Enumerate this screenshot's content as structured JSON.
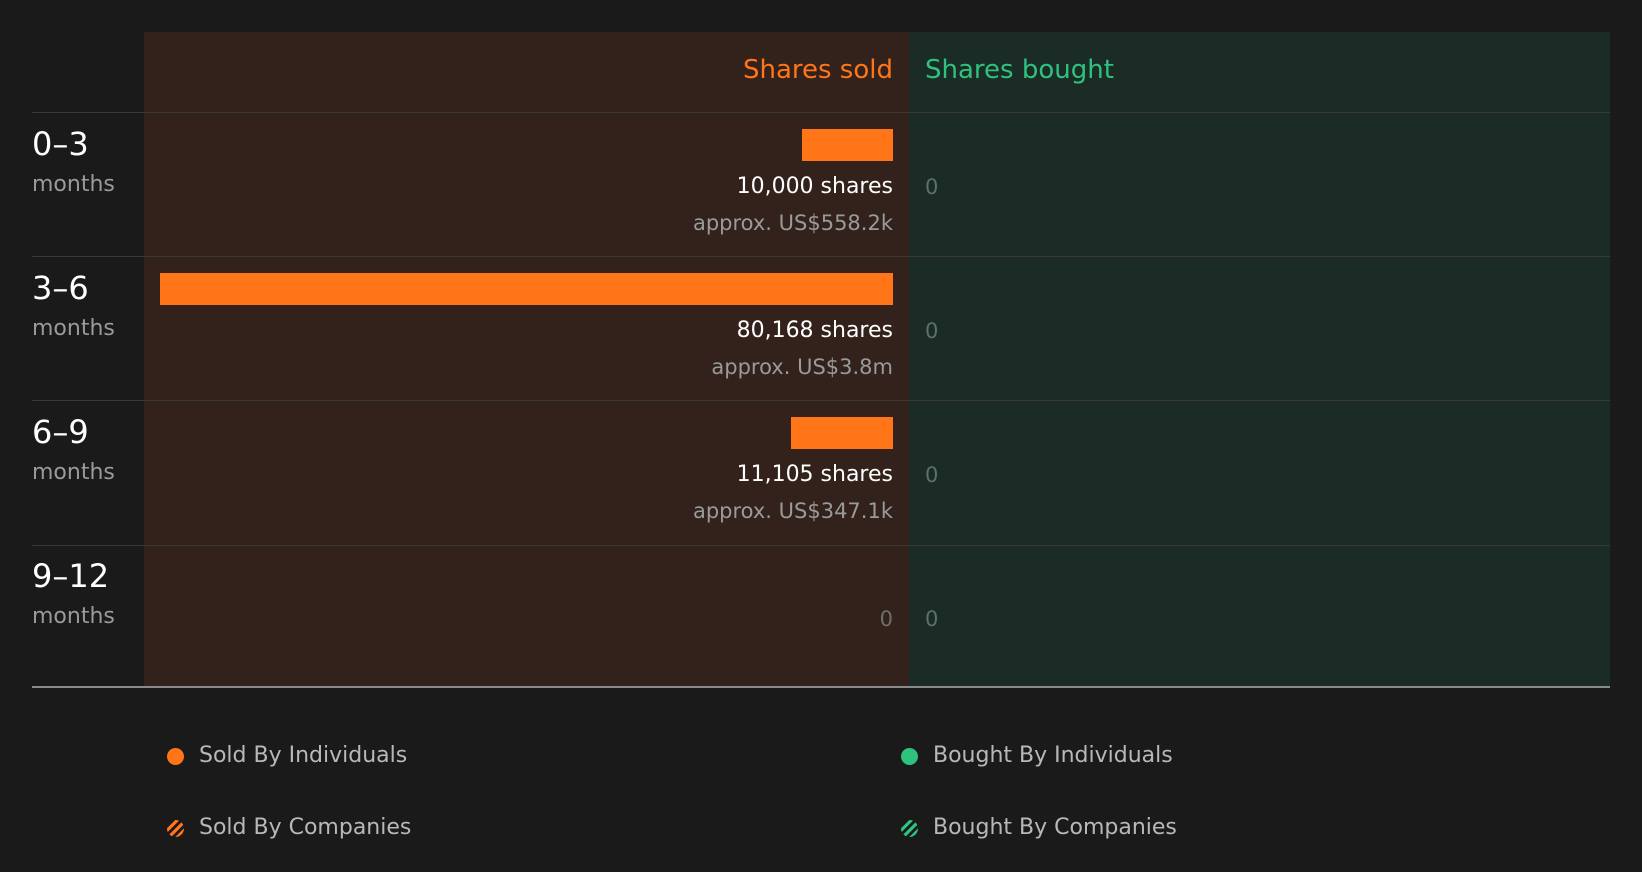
{
  "colors": {
    "sold": "#ff7518",
    "bought": "#2ec27e"
  },
  "headers": {
    "sold": "Shares sold",
    "bought": "Shares bought"
  },
  "rows": [
    {
      "range": "0–3",
      "unit": "months",
      "shares_label": "10,000 shares",
      "approx_label": "approx. US$558.2k",
      "bought_label": "0"
    },
    {
      "range": "3–6",
      "unit": "months",
      "shares_label": "80,168 shares",
      "approx_label": "approx. US$3.8m",
      "bought_label": "0"
    },
    {
      "range": "6–9",
      "unit": "months",
      "shares_label": "11,105 shares",
      "approx_label": "approx. US$347.1k",
      "bought_label": "0"
    },
    {
      "range": "9–12",
      "unit": "months",
      "sold_zero_label": "0",
      "bought_label": "0"
    }
  ],
  "legend": [
    {
      "label": "Sold By Individuals",
      "icon": "solid-dot-icon",
      "color": "#ff7518"
    },
    {
      "label": "Bought By Individuals",
      "icon": "solid-dot-icon",
      "color": "#2ec27e"
    },
    {
      "label": "Sold By Companies",
      "icon": "hatched-dot-icon",
      "color": "#ff7518"
    },
    {
      "label": "Bought By Companies",
      "icon": "hatched-dot-icon",
      "color": "#2ec27e"
    }
  ],
  "chart_data": {
    "type": "bar",
    "categories": [
      "0–3 months",
      "3–6 months",
      "6–9 months",
      "9–12 months"
    ],
    "series": [
      {
        "name": "Shares sold",
        "values": [
          10000,
          80168,
          11105,
          0
        ]
      },
      {
        "name": "Shares bought",
        "values": [
          0,
          0,
          0,
          0
        ]
      }
    ],
    "xlim": [
      0,
      80168
    ]
  }
}
